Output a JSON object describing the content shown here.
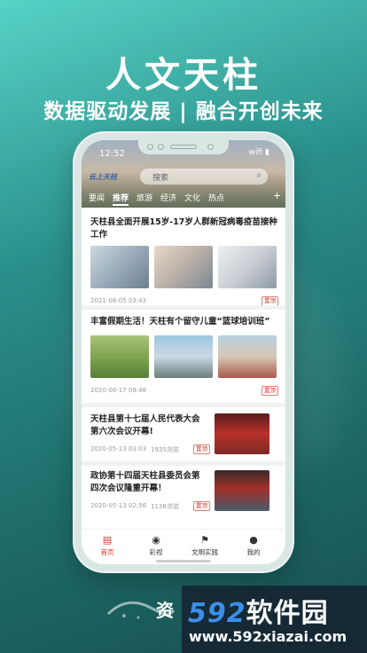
{
  "poster": {
    "headline": "人文天柱",
    "subline": "数据驱动发展 | 融合开创未来",
    "bottom_text": "资",
    "watermark_brand_num": "592",
    "watermark_brand_cn": "软件园",
    "watermark_url": "www.592xiazai.com"
  },
  "status": {
    "time": "12:52",
    "icons": "wifi ▮"
  },
  "app": {
    "logo": "云上天柱",
    "search_placeholder": "搜索",
    "tabs": [
      "要闻",
      "推荐",
      "旅游",
      "经济",
      "文化",
      "热点"
    ],
    "active_tab": "推荐",
    "add_tab": "+"
  },
  "feed": [
    {
      "title": "天柱县全面开展15岁-17岁人群新冠病毒疫苗接种工作",
      "date": "2021-08-05 03:43",
      "views": "",
      "badge": "置顶"
    },
    {
      "title": "丰富假期生活！天柱有个留守儿童“篮球培训班”",
      "date": "2020-08-17 09:48",
      "views": "",
      "badge": "置顶"
    },
    {
      "title": "天柱县第十七届人民代表大会第六次会议开幕!",
      "date": "2020-05-13 03:03",
      "views": "1935浏览",
      "badge": "置顶"
    },
    {
      "title": "政协第十四届天柱县委员会第四次会议隆重开幕！",
      "date": "2020-05-13 02:56",
      "views": "1138浏览",
      "badge": "置顶"
    }
  ],
  "bottom_nav": [
    {
      "label": "首页",
      "icon": "home-icon",
      "active": true
    },
    {
      "label": "彩视",
      "icon": "play-icon",
      "active": false
    },
    {
      "label": "文明实践",
      "icon": "flag-icon",
      "active": false
    },
    {
      "label": "我的",
      "icon": "user-icon",
      "active": false
    }
  ],
  "colors": {
    "accent": "#d0342c",
    "bg_teal": "#2a8f8a"
  }
}
